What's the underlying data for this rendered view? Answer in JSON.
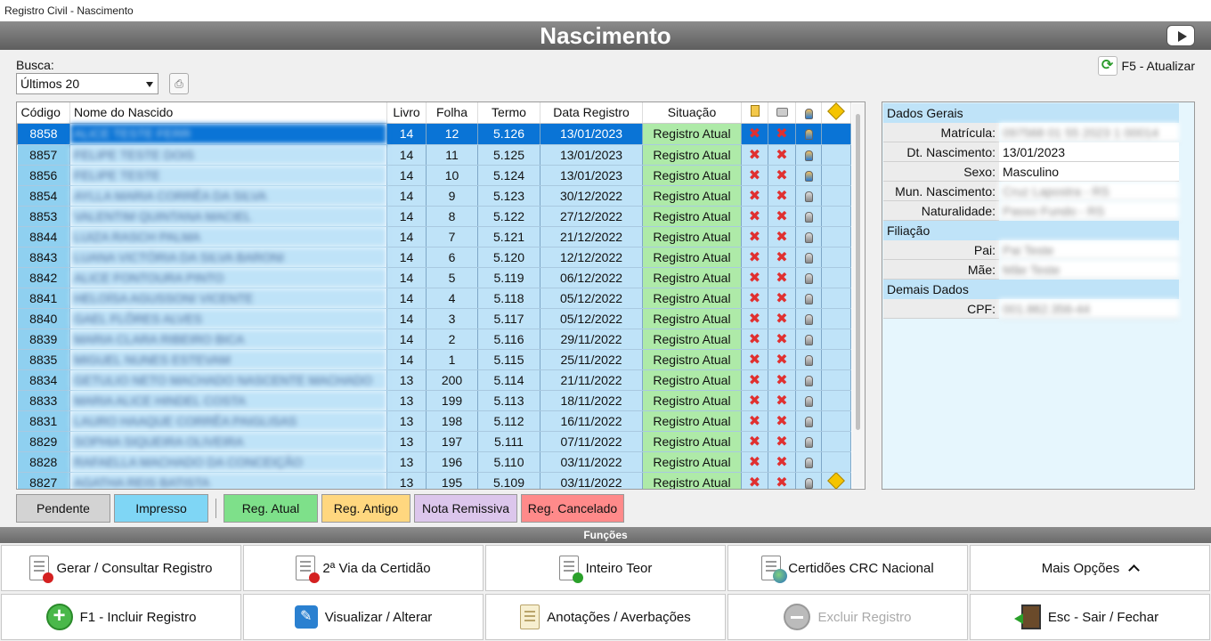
{
  "window": {
    "title": "Registro Civil - Nascimento"
  },
  "header": {
    "title": "Nascimento"
  },
  "search": {
    "label": "Busca:",
    "selected": "Últimos 20"
  },
  "refresh": {
    "label": "F5 - Atualizar"
  },
  "table": {
    "columns": [
      "Código",
      "Nome do Nascido",
      "Livro",
      "Folha",
      "Termo",
      "Data Registro",
      "Situação"
    ],
    "rows": [
      {
        "codigo": "8858",
        "nome": "ALICE TESTE FERR",
        "livro": "14",
        "folha": "12",
        "termo": "5.126",
        "data": "13/01/2023",
        "situacao": "Registro Atual",
        "selected": true,
        "flag": false,
        "active": true
      },
      {
        "codigo": "8857",
        "nome": "FELIPE TESTE DOIS",
        "livro": "14",
        "folha": "11",
        "termo": "5.125",
        "data": "13/01/2023",
        "situacao": "Registro Atual",
        "selected": false,
        "flag": false,
        "active": true
      },
      {
        "codigo": "8856",
        "nome": "FELIPE TESTE",
        "livro": "14",
        "folha": "10",
        "termo": "5.124",
        "data": "13/01/2023",
        "situacao": "Registro Atual",
        "selected": false,
        "flag": false,
        "active": true
      },
      {
        "codigo": "8854",
        "nome": "AYLLA MARIA CORRÊA DA SILVA",
        "livro": "14",
        "folha": "9",
        "termo": "5.123",
        "data": "30/12/2022",
        "situacao": "Registro Atual",
        "selected": false,
        "flag": false,
        "active": false
      },
      {
        "codigo": "8853",
        "nome": "VALENTIM QUINTANA MACIEL",
        "livro": "14",
        "folha": "8",
        "termo": "5.122",
        "data": "27/12/2022",
        "situacao": "Registro Atual",
        "selected": false,
        "flag": false,
        "active": false
      },
      {
        "codigo": "8844",
        "nome": "LUIZA RASCH PALMA",
        "livro": "14",
        "folha": "7",
        "termo": "5.121",
        "data": "21/12/2022",
        "situacao": "Registro Atual",
        "selected": false,
        "flag": false,
        "active": false
      },
      {
        "codigo": "8843",
        "nome": "LUANA VICTÓRIA DA SILVA BARONI",
        "livro": "14",
        "folha": "6",
        "termo": "5.120",
        "data": "12/12/2022",
        "situacao": "Registro Atual",
        "selected": false,
        "flag": false,
        "active": false
      },
      {
        "codigo": "8842",
        "nome": "ALICE FONTOURA PINTO",
        "livro": "14",
        "folha": "5",
        "termo": "5.119",
        "data": "06/12/2022",
        "situacao": "Registro Atual",
        "selected": false,
        "flag": false,
        "active": false
      },
      {
        "codigo": "8841",
        "nome": "HELOÍSA AGUSSONI VICENTE",
        "livro": "14",
        "folha": "4",
        "termo": "5.118",
        "data": "05/12/2022",
        "situacao": "Registro Atual",
        "selected": false,
        "flag": false,
        "active": false
      },
      {
        "codigo": "8840",
        "nome": "GAEL FLÔRES ALVES",
        "livro": "14",
        "folha": "3",
        "termo": "5.117",
        "data": "05/12/2022",
        "situacao": "Registro Atual",
        "selected": false,
        "flag": false,
        "active": false
      },
      {
        "codigo": "8839",
        "nome": "MARIA CLARA RIBEIRO BICA",
        "livro": "14",
        "folha": "2",
        "termo": "5.116",
        "data": "29/11/2022",
        "situacao": "Registro Atual",
        "selected": false,
        "flag": false,
        "active": false
      },
      {
        "codigo": "8835",
        "nome": "MIGUEL NUNES ESTEVAM",
        "livro": "14",
        "folha": "1",
        "termo": "5.115",
        "data": "25/11/2022",
        "situacao": "Registro Atual",
        "selected": false,
        "flag": false,
        "active": false
      },
      {
        "codigo": "8834",
        "nome": "GETULIO NETO MACHADO NASCENTE MACHADO",
        "livro": "13",
        "folha": "200",
        "termo": "5.114",
        "data": "21/11/2022",
        "situacao": "Registro Atual",
        "selected": false,
        "flag": false,
        "active": false
      },
      {
        "codigo": "8833",
        "nome": "MARIA ALICE HINDEL COSTA",
        "livro": "13",
        "folha": "199",
        "termo": "5.113",
        "data": "18/11/2022",
        "situacao": "Registro Atual",
        "selected": false,
        "flag": false,
        "active": false
      },
      {
        "codigo": "8831",
        "nome": "LAURO HAAQUE CORRÊA PAIGLISAS",
        "livro": "13",
        "folha": "198",
        "termo": "5.112",
        "data": "16/11/2022",
        "situacao": "Registro Atual",
        "selected": false,
        "flag": false,
        "active": false
      },
      {
        "codigo": "8829",
        "nome": "SOPHIA SIQUEIRA OLIVEIRA",
        "livro": "13",
        "folha": "197",
        "termo": "5.111",
        "data": "07/11/2022",
        "situacao": "Registro Atual",
        "selected": false,
        "flag": false,
        "active": false
      },
      {
        "codigo": "8828",
        "nome": "RAFAELLA MACHADO DA CONCEIÇÃO",
        "livro": "13",
        "folha": "196",
        "termo": "5.110",
        "data": "03/11/2022",
        "situacao": "Registro Atual",
        "selected": false,
        "flag": false,
        "active": false
      },
      {
        "codigo": "8827",
        "nome": "AGATHA REIS BATISTA",
        "livro": "13",
        "folha": "195",
        "termo": "5.109",
        "data": "03/11/2022",
        "situacao": "Registro Atual",
        "selected": false,
        "flag": true,
        "active": false
      }
    ]
  },
  "legend": [
    {
      "label": "Pendente",
      "color": "#d3d3d3"
    },
    {
      "label": "Impresso",
      "color": "#7fd6f5"
    },
    {
      "label": "Reg. Atual",
      "color": "#7ee08a"
    },
    {
      "label": "Reg. Antigo",
      "color": "#ffd77f"
    },
    {
      "label": "Nota Remissiva",
      "color": "#dcc6ec"
    },
    {
      "label": "Reg. Cancelado",
      "color": "#ff8a8a"
    }
  ],
  "details": {
    "dados_gerais": "Dados Gerais",
    "matricula_lbl": "Matrícula:",
    "matricula": "097568 01 55 2023 1 00014",
    "dt_nasc_lbl": "Dt. Nascimento:",
    "dt_nasc": "13/01/2023",
    "sexo_lbl": "Sexo:",
    "sexo": "Masculino",
    "mun_lbl": "Mun. Nascimento:",
    "mun": "Cruz Lapostra - RS",
    "nat_lbl": "Naturalidade:",
    "nat": "Passo Fundo - RS",
    "filiacao": "Filiação",
    "pai_lbl": "Pai:",
    "pai": "Pai Teste",
    "mae_lbl": "Mãe:",
    "mae": "Mãe Teste",
    "demais": "Demais Dados",
    "cpf_lbl": "CPF:",
    "cpf": "001.862.356-44"
  },
  "functions": {
    "title": "Funções",
    "gerar": "Gerar / Consultar Registro",
    "segunda_via": "2ª Via da Certidão",
    "inteiro_teor": "Inteiro Teor",
    "crc": "Certidões CRC Nacional",
    "mais": "Mais Opções",
    "incluir": "F1 - Incluir Registro",
    "visualizar": "Visualizar / Alterar",
    "anotacoes": "Anotações / Averbações",
    "excluir": "Excluir Registro",
    "sair": "Esc - Sair / Fechar"
  }
}
